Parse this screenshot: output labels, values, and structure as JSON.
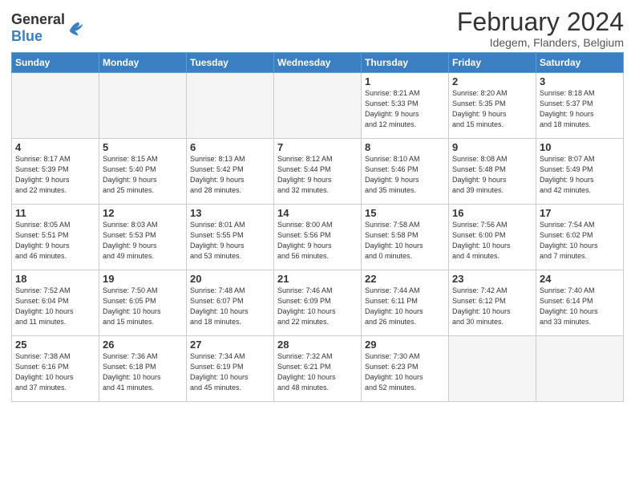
{
  "header": {
    "logo_general": "General",
    "logo_blue": "Blue",
    "title": "February 2024",
    "subtitle": "Idegem, Flanders, Belgium"
  },
  "weekdays": [
    "Sunday",
    "Monday",
    "Tuesday",
    "Wednesday",
    "Thursday",
    "Friday",
    "Saturday"
  ],
  "weeks": [
    [
      {
        "day": "",
        "info": ""
      },
      {
        "day": "",
        "info": ""
      },
      {
        "day": "",
        "info": ""
      },
      {
        "day": "",
        "info": ""
      },
      {
        "day": "1",
        "info": "Sunrise: 8:21 AM\nSunset: 5:33 PM\nDaylight: 9 hours\nand 12 minutes."
      },
      {
        "day": "2",
        "info": "Sunrise: 8:20 AM\nSunset: 5:35 PM\nDaylight: 9 hours\nand 15 minutes."
      },
      {
        "day": "3",
        "info": "Sunrise: 8:18 AM\nSunset: 5:37 PM\nDaylight: 9 hours\nand 18 minutes."
      }
    ],
    [
      {
        "day": "4",
        "info": "Sunrise: 8:17 AM\nSunset: 5:39 PM\nDaylight: 9 hours\nand 22 minutes."
      },
      {
        "day": "5",
        "info": "Sunrise: 8:15 AM\nSunset: 5:40 PM\nDaylight: 9 hours\nand 25 minutes."
      },
      {
        "day": "6",
        "info": "Sunrise: 8:13 AM\nSunset: 5:42 PM\nDaylight: 9 hours\nand 28 minutes."
      },
      {
        "day": "7",
        "info": "Sunrise: 8:12 AM\nSunset: 5:44 PM\nDaylight: 9 hours\nand 32 minutes."
      },
      {
        "day": "8",
        "info": "Sunrise: 8:10 AM\nSunset: 5:46 PM\nDaylight: 9 hours\nand 35 minutes."
      },
      {
        "day": "9",
        "info": "Sunrise: 8:08 AM\nSunset: 5:48 PM\nDaylight: 9 hours\nand 39 minutes."
      },
      {
        "day": "10",
        "info": "Sunrise: 8:07 AM\nSunset: 5:49 PM\nDaylight: 9 hours\nand 42 minutes."
      }
    ],
    [
      {
        "day": "11",
        "info": "Sunrise: 8:05 AM\nSunset: 5:51 PM\nDaylight: 9 hours\nand 46 minutes."
      },
      {
        "day": "12",
        "info": "Sunrise: 8:03 AM\nSunset: 5:53 PM\nDaylight: 9 hours\nand 49 minutes."
      },
      {
        "day": "13",
        "info": "Sunrise: 8:01 AM\nSunset: 5:55 PM\nDaylight: 9 hours\nand 53 minutes."
      },
      {
        "day": "14",
        "info": "Sunrise: 8:00 AM\nSunset: 5:56 PM\nDaylight: 9 hours\nand 56 minutes."
      },
      {
        "day": "15",
        "info": "Sunrise: 7:58 AM\nSunset: 5:58 PM\nDaylight: 10 hours\nand 0 minutes."
      },
      {
        "day": "16",
        "info": "Sunrise: 7:56 AM\nSunset: 6:00 PM\nDaylight: 10 hours\nand 4 minutes."
      },
      {
        "day": "17",
        "info": "Sunrise: 7:54 AM\nSunset: 6:02 PM\nDaylight: 10 hours\nand 7 minutes."
      }
    ],
    [
      {
        "day": "18",
        "info": "Sunrise: 7:52 AM\nSunset: 6:04 PM\nDaylight: 10 hours\nand 11 minutes."
      },
      {
        "day": "19",
        "info": "Sunrise: 7:50 AM\nSunset: 6:05 PM\nDaylight: 10 hours\nand 15 minutes."
      },
      {
        "day": "20",
        "info": "Sunrise: 7:48 AM\nSunset: 6:07 PM\nDaylight: 10 hours\nand 18 minutes."
      },
      {
        "day": "21",
        "info": "Sunrise: 7:46 AM\nSunset: 6:09 PM\nDaylight: 10 hours\nand 22 minutes."
      },
      {
        "day": "22",
        "info": "Sunrise: 7:44 AM\nSunset: 6:11 PM\nDaylight: 10 hours\nand 26 minutes."
      },
      {
        "day": "23",
        "info": "Sunrise: 7:42 AM\nSunset: 6:12 PM\nDaylight: 10 hours\nand 30 minutes."
      },
      {
        "day": "24",
        "info": "Sunrise: 7:40 AM\nSunset: 6:14 PM\nDaylight: 10 hours\nand 33 minutes."
      }
    ],
    [
      {
        "day": "25",
        "info": "Sunrise: 7:38 AM\nSunset: 6:16 PM\nDaylight: 10 hours\nand 37 minutes."
      },
      {
        "day": "26",
        "info": "Sunrise: 7:36 AM\nSunset: 6:18 PM\nDaylight: 10 hours\nand 41 minutes."
      },
      {
        "day": "27",
        "info": "Sunrise: 7:34 AM\nSunset: 6:19 PM\nDaylight: 10 hours\nand 45 minutes."
      },
      {
        "day": "28",
        "info": "Sunrise: 7:32 AM\nSunset: 6:21 PM\nDaylight: 10 hours\nand 48 minutes."
      },
      {
        "day": "29",
        "info": "Sunrise: 7:30 AM\nSunset: 6:23 PM\nDaylight: 10 hours\nand 52 minutes."
      },
      {
        "day": "",
        "info": ""
      },
      {
        "day": "",
        "info": ""
      }
    ]
  ]
}
